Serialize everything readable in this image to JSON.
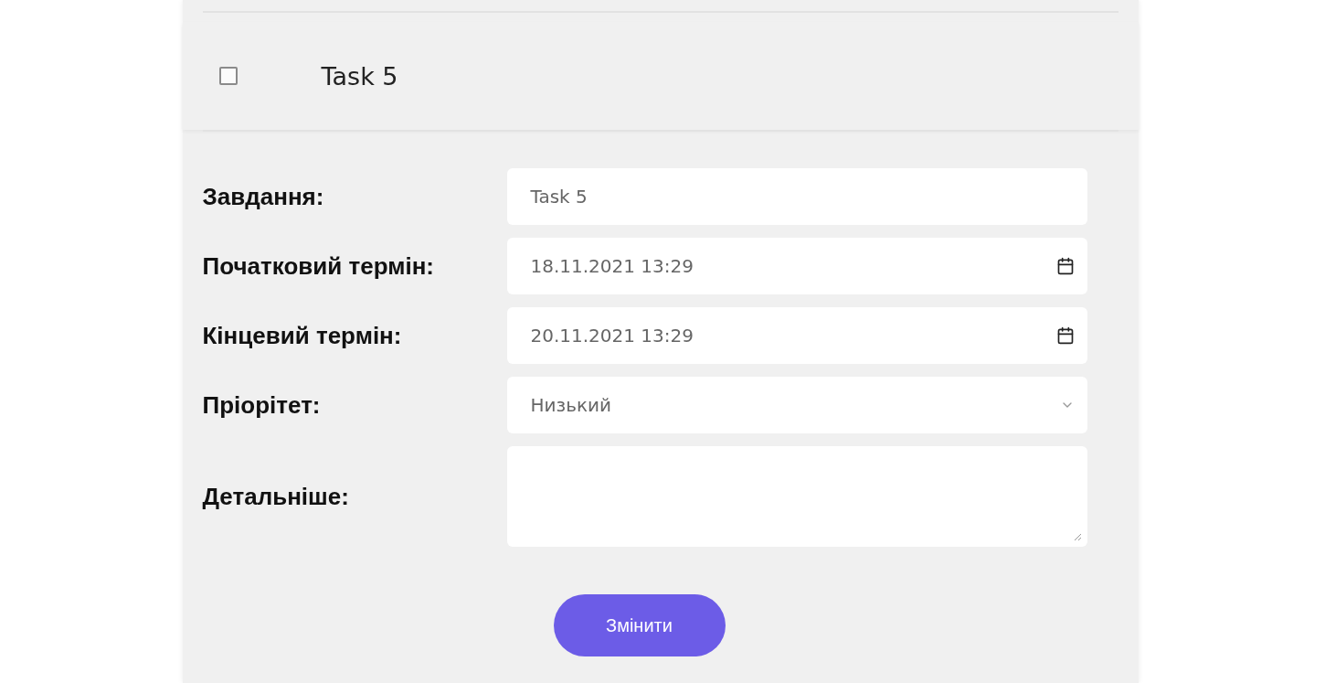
{
  "task": {
    "title": "Task 5",
    "checked": false
  },
  "form": {
    "fields": [
      {
        "kind": "text",
        "label": "Завдання:",
        "value": "Task 5"
      },
      {
        "kind": "datetime",
        "label": "Початковий термін:",
        "value": "18.11.2021 13:29"
      },
      {
        "kind": "datetime",
        "label": "Кінцевий термін:",
        "value": "20.11.2021 13:29"
      },
      {
        "kind": "select",
        "label": "Пріорітет:",
        "value": "Низький"
      },
      {
        "kind": "textarea",
        "label": "Детальніше:"
      }
    ],
    "submit": "Змінити"
  }
}
